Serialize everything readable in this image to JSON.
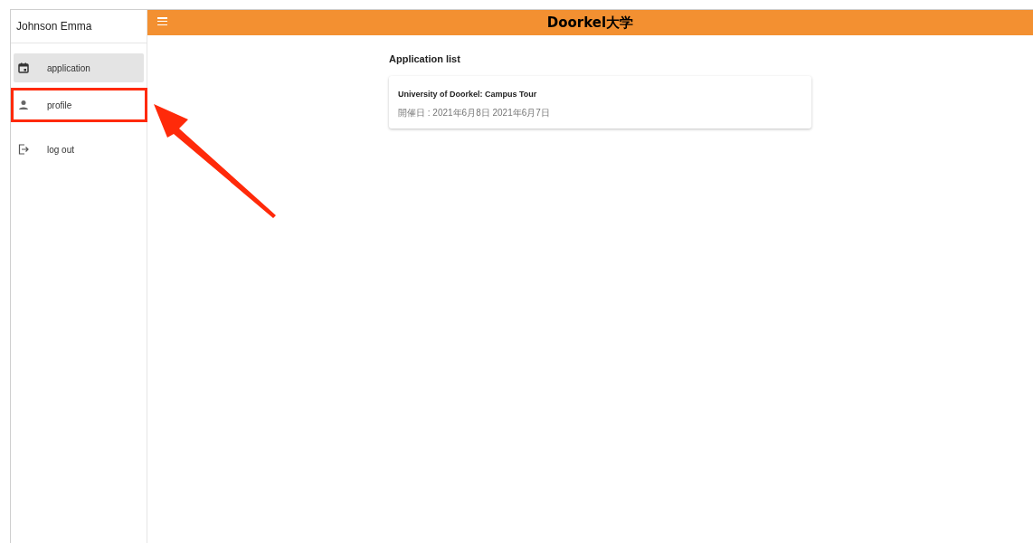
{
  "sidebar": {
    "user_name": "Johnson Emma",
    "items": [
      {
        "kind": "calendar",
        "label": "application",
        "selected": true,
        "highlighted": false
      },
      {
        "kind": "person",
        "label": "profile",
        "selected": false,
        "highlighted": true
      },
      {
        "kind": "logout",
        "label": "log out",
        "selected": false,
        "highlighted": false
      }
    ]
  },
  "app_bar": {
    "title": "Doorkel大学"
  },
  "content": {
    "heading": "Application list",
    "cards": [
      {
        "title": "University of Doorkel: Campus Tour",
        "dates": "開催日 : 2021年6月8日 2021年6月7日"
      }
    ]
  }
}
